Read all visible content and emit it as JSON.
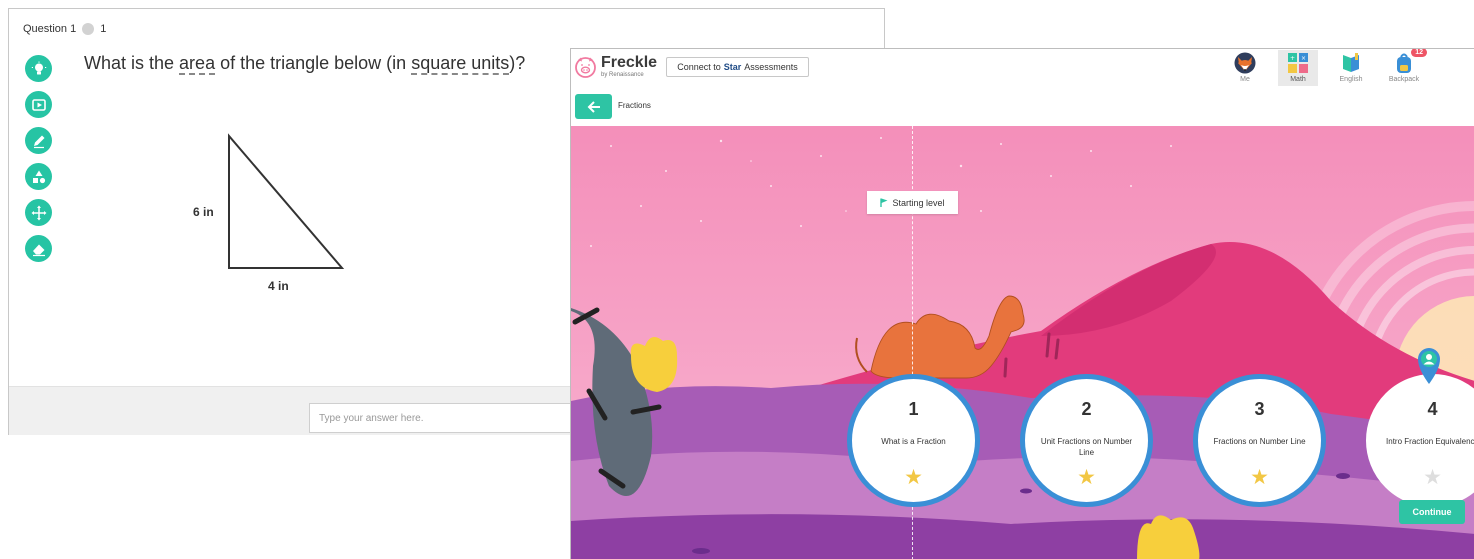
{
  "question": {
    "header_label": "Question 1",
    "header_count": "1",
    "prompt_before": "What is the ",
    "prompt_vocab_1": "area",
    "prompt_middle": " of the triangle below (in ",
    "prompt_vocab_2": "square units",
    "prompt_after": ")?",
    "side_label_height": "6 in",
    "side_label_base": "4 in",
    "answer_placeholder": "Type your answer here.",
    "tools": [
      "lightbulb-icon",
      "video-play-icon",
      "pencil-icon",
      "shapes-icon",
      "move-arrows-icon",
      "eraser-icon"
    ]
  },
  "freckle": {
    "logo": {
      "name": "Freckle",
      "byline": "by Renaissance"
    },
    "connect_button": {
      "prefix": "Connect to",
      "brand": "Star",
      "suffix": "Assessments"
    },
    "nav": [
      {
        "label": "Me",
        "icon": "fox-avatar-icon"
      },
      {
        "label": "Math",
        "icon": "math-blocks-icon",
        "active": true
      },
      {
        "label": "English",
        "icon": "book-icon"
      },
      {
        "label": "Backpack",
        "icon": "backpack-icon",
        "badge": "12"
      }
    ],
    "breadcrumb": "Fractions",
    "starting_level": "Starting level",
    "levels": [
      {
        "number": "1",
        "title": "What is a Fraction",
        "starred": true
      },
      {
        "number": "2",
        "title": "Unit Fractions on Number Line",
        "starred": true
      },
      {
        "number": "3",
        "title": "Fractions on Number Line",
        "starred": true
      },
      {
        "number": "4",
        "title": "Intro Fraction Equivalence",
        "starred": false
      }
    ],
    "continue_label": "Continue",
    "colors": {
      "teal": "#2ec4a4",
      "level_ring": "#3a8fd6",
      "star": "#f2c744",
      "sky": "#f79bc1",
      "ground": "#a75cb6"
    }
  }
}
